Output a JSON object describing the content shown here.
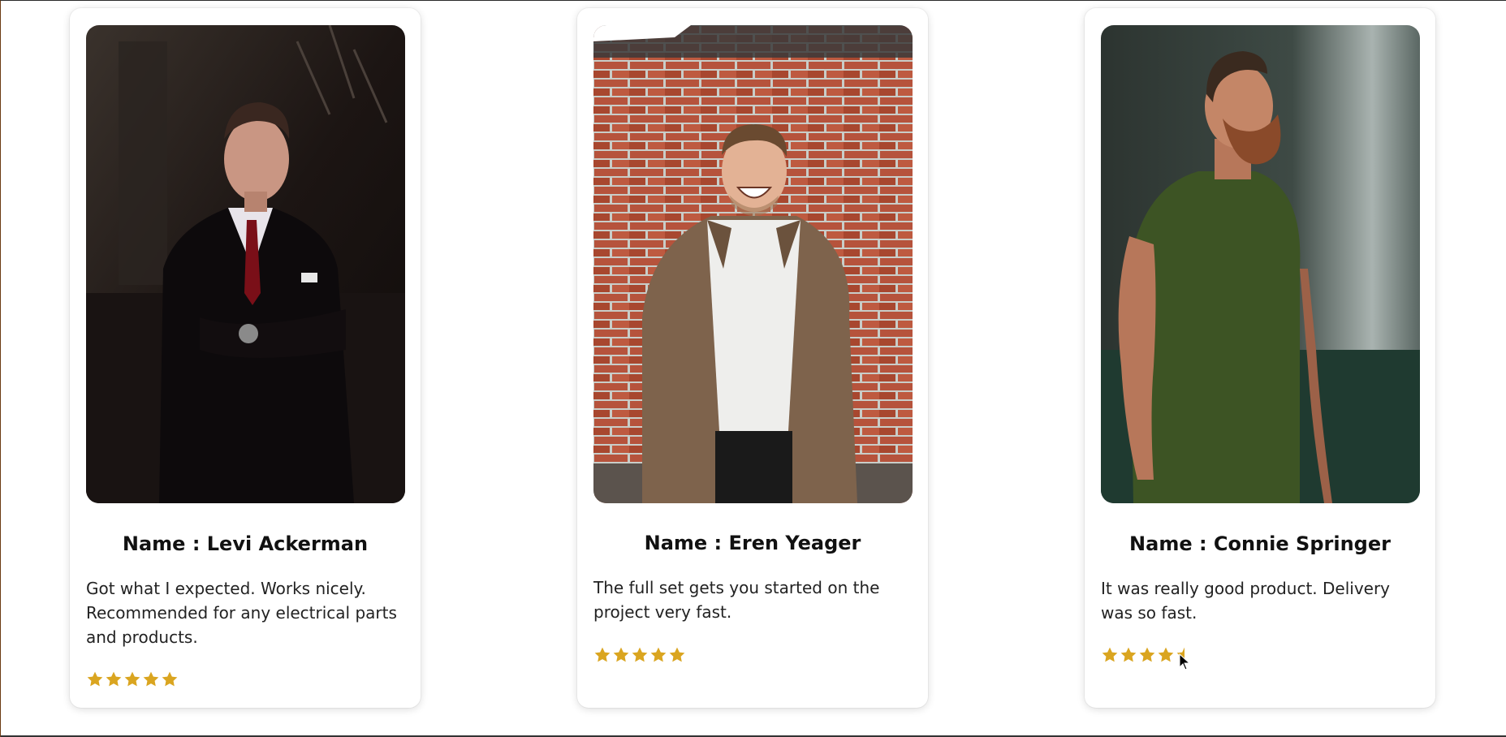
{
  "colors": {
    "star": "#DAA520",
    "card_bg": "#ffffff",
    "text": "#111111"
  },
  "testimonials": [
    {
      "photo_icon": "person-in-suit-photo",
      "name": "Name : Levi Ackerman",
      "review": "Got what I expected. Works nicely. Recommended for any electrical parts and products.",
      "rating": 5
    },
    {
      "photo_icon": "person-laughing-brick-wall-photo",
      "name": "Name : Eren Yeager",
      "review": "The full set gets you started on the project very fast.",
      "rating": 5
    },
    {
      "photo_icon": "bearded-man-green-shirt-photo",
      "name": "Name : Connie Springer",
      "review": "It was really good product. Delivery was so fast.",
      "rating": 4.5
    }
  ]
}
